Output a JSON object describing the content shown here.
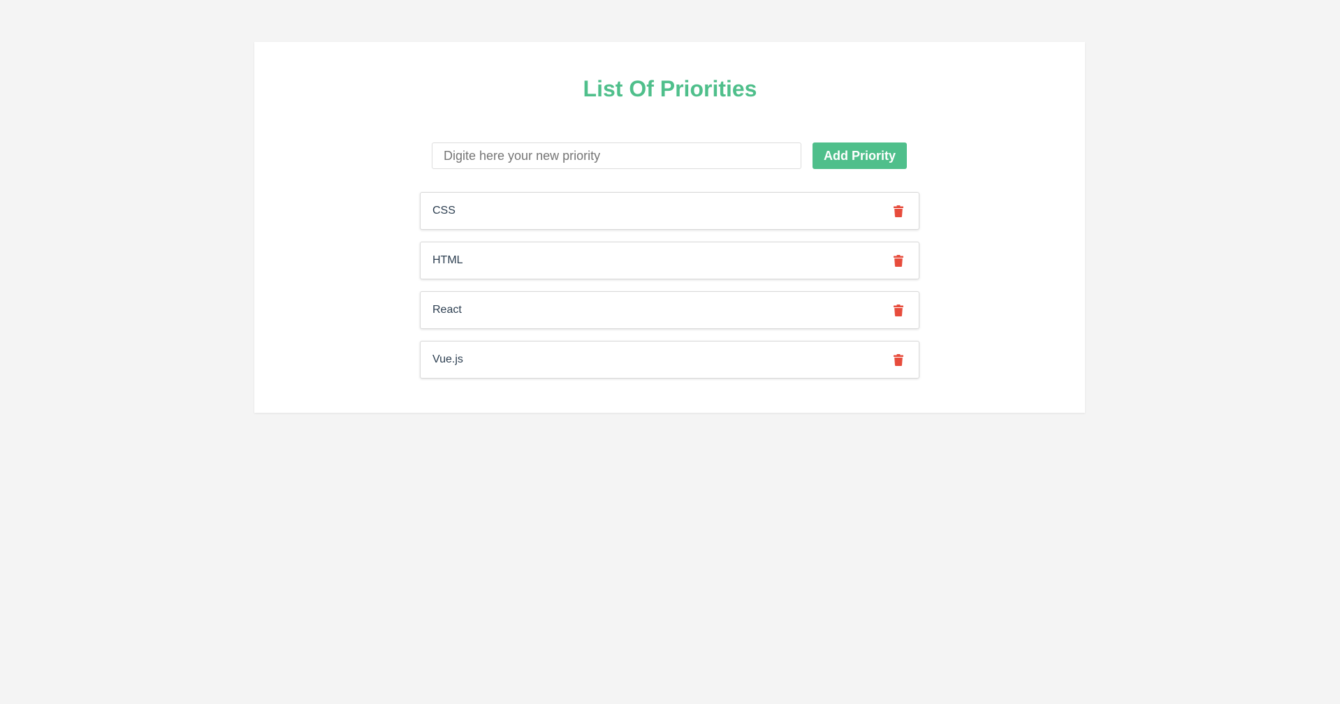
{
  "app": {
    "title": "List Of Priorities"
  },
  "form": {
    "placeholder": "Digite here your new priority",
    "value": "",
    "add_label": "Add Priority"
  },
  "priorities": [
    {
      "label": "CSS"
    },
    {
      "label": "HTML"
    },
    {
      "label": "React"
    },
    {
      "label": "Vue.js"
    }
  ],
  "icons": {
    "delete": "trash-icon"
  },
  "colors": {
    "accent": "#4fbf8b",
    "danger": "#e74c3c",
    "text": "#2c3e50",
    "background": "#f4f4f4"
  }
}
